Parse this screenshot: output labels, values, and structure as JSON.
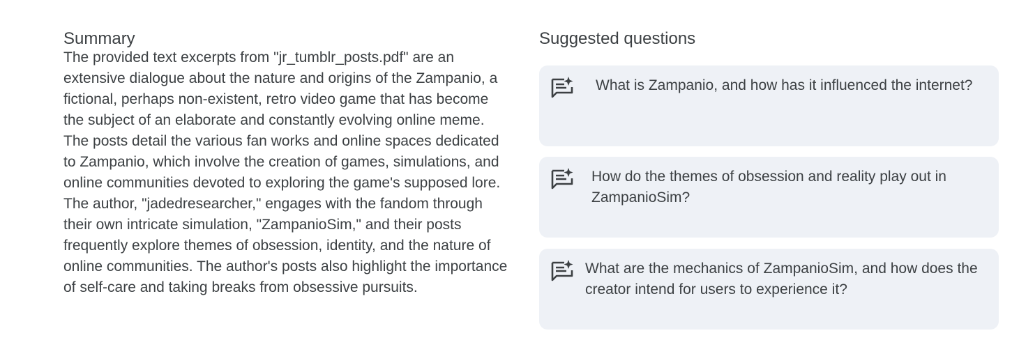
{
  "summary": {
    "title": "Summary",
    "text": "The provided text excerpts from \"jr_tumblr_posts.pdf\" are an extensive dialogue about the nature and origins of the Zampanio, a fictional, perhaps non-existent, retro video game that has become the subject of an elaborate and constantly evolving online meme. The posts detail the various fan works and online spaces dedicated to Zampanio, which involve the creation of games, simulations, and online communities devoted to exploring the game's supposed lore. The author, \"jadedresearcher,\" engages with the fandom through their own intricate simulation, \"ZampanioSim,\" and their posts frequently explore themes of obsession, identity, and the nature of online communities. The author's posts also highlight the importance of self-care and taking breaks from obsessive pursuits."
  },
  "suggested": {
    "title": "Suggested questions",
    "icon": "notes-sparkle-icon",
    "questions": [
      {
        "text": "What is Zampanio, and how has it influenced the internet?"
      },
      {
        "text": "How do the themes of obsession and reality play out in ZampanioSim?"
      },
      {
        "text": "What are the mechanics of ZampanioSim, and how does the creator intend for users to experience it?"
      }
    ]
  },
  "colors": {
    "text": "#3c4043",
    "card_background": "#eef1f6",
    "icon": "#3c4043"
  }
}
